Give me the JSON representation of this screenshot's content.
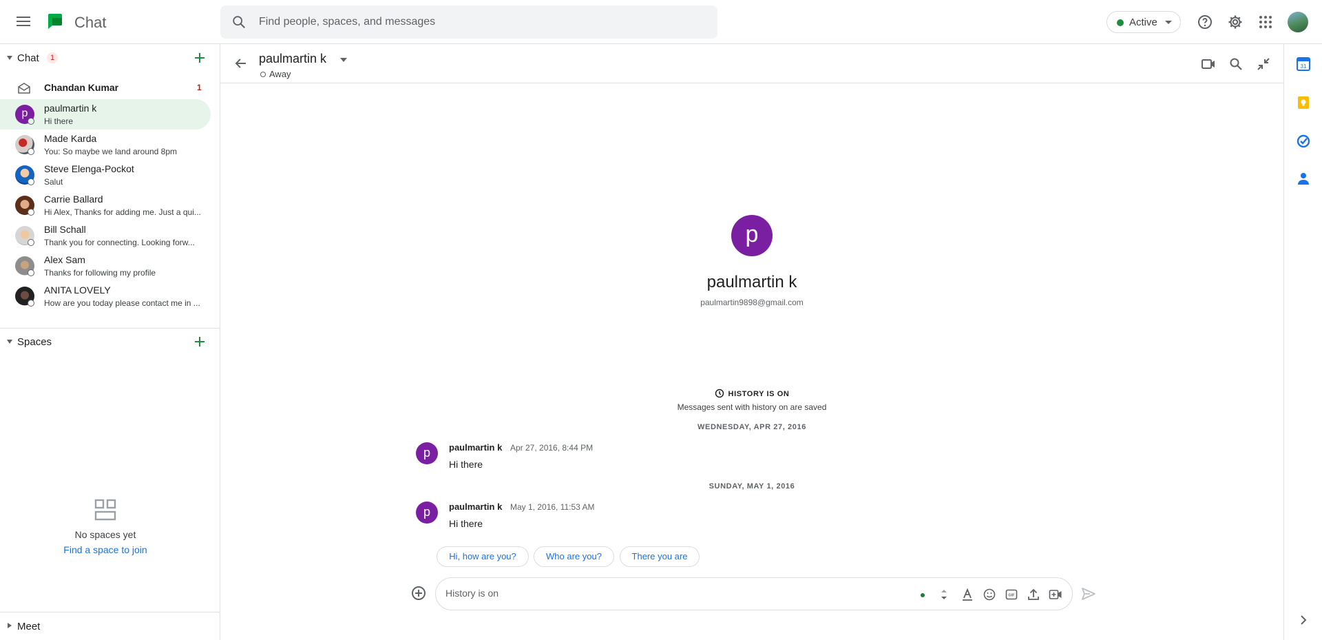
{
  "app": {
    "title": "Chat"
  },
  "search": {
    "placeholder": "Find people, spaces, and messages"
  },
  "status": {
    "label": "Active",
    "color": "#1e8e3e"
  },
  "sidebar": {
    "chat_section": {
      "label": "Chat",
      "badge": "1"
    },
    "chats": [
      {
        "name": "Chandan Kumar",
        "snippet": "",
        "count": "1",
        "unread": true
      },
      {
        "name": "paulmartin k",
        "snippet": "Hi there",
        "initial": "p",
        "active": true
      },
      {
        "name": "Made Karda",
        "snippet": "You: So maybe we land around 8pm"
      },
      {
        "name": "Steve Elenga-Pockot",
        "snippet": "Salut"
      },
      {
        "name": "Carrie Ballard",
        "snippet": "Hi Alex, Thanks for adding me. Just a qui..."
      },
      {
        "name": "Bill Schall",
        "snippet": " Thank you for connecting. Looking forw..."
      },
      {
        "name": "Alex Sam",
        "snippet": "Thanks for following my profile"
      },
      {
        "name": "ANITA LOVELY",
        "snippet": "How are you today please contact me in ..."
      }
    ],
    "spaces_section": {
      "label": "Spaces"
    },
    "spaces_empty": {
      "title": "No spaces yet",
      "link": "Find a space to join"
    },
    "meet_section": {
      "label": "Meet"
    }
  },
  "conversation": {
    "name": "paulmartin k",
    "status": "Away",
    "profile": {
      "initial": "p",
      "name": "paulmartin k",
      "email": "paulmartin9898@gmail.com"
    },
    "history": {
      "title": "HISTORY IS ON",
      "subtitle": "Messages sent with history on are saved"
    },
    "groups": [
      {
        "date": "WEDNESDAY, APR 27, 2016",
        "sender": "paulmartin k",
        "time": "Apr 27, 2016, 8:44 PM",
        "text": "Hi there",
        "initial": "p"
      },
      {
        "date": "SUNDAY, MAY 1, 2016",
        "sender": "paulmartin k",
        "time": "May 1, 2016, 11:53 AM",
        "text": "Hi there",
        "initial": "p"
      }
    ],
    "suggestions": [
      "Hi, how are you?",
      "Who are you?",
      "There you are"
    ],
    "composer": {
      "placeholder": "History is on"
    }
  },
  "colors": {
    "accent": "#1a73e8",
    "avatar_purple": "#7b1fa2",
    "active_bg": "#e6f4ea",
    "badge_red": "#c5221f"
  }
}
